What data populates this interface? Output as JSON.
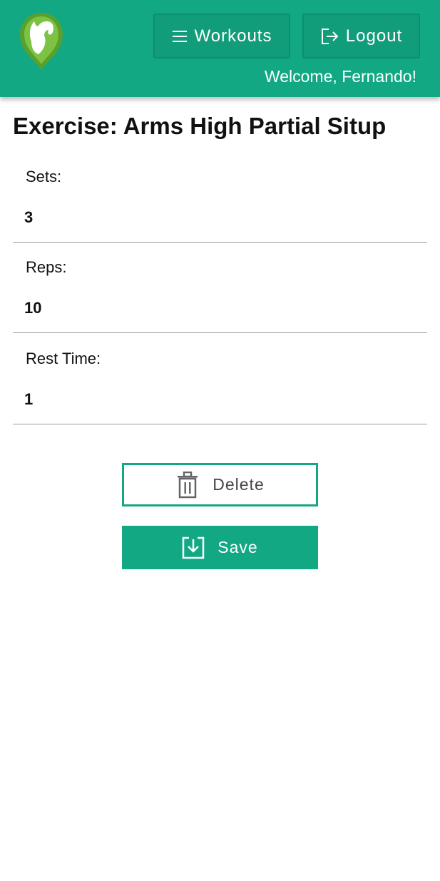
{
  "header": {
    "logo_icon": "flexed-arm-logo-icon",
    "workouts_label": "Workouts",
    "logout_label": "Logout",
    "welcome_text": "Welcome, Fernando!",
    "brand_color": "#13a884"
  },
  "page": {
    "title": "Exercise: Arms High Partial Situp"
  },
  "fields": {
    "sets": {
      "label": "Sets:",
      "value": "3"
    },
    "reps": {
      "label": "Reps:",
      "value": "10"
    },
    "rest": {
      "label": "Rest Time:",
      "value": "1"
    }
  },
  "actions": {
    "delete_label": "Delete",
    "delete_icon": "trash-icon",
    "save_label": "Save",
    "save_icon": "save-download-icon"
  }
}
